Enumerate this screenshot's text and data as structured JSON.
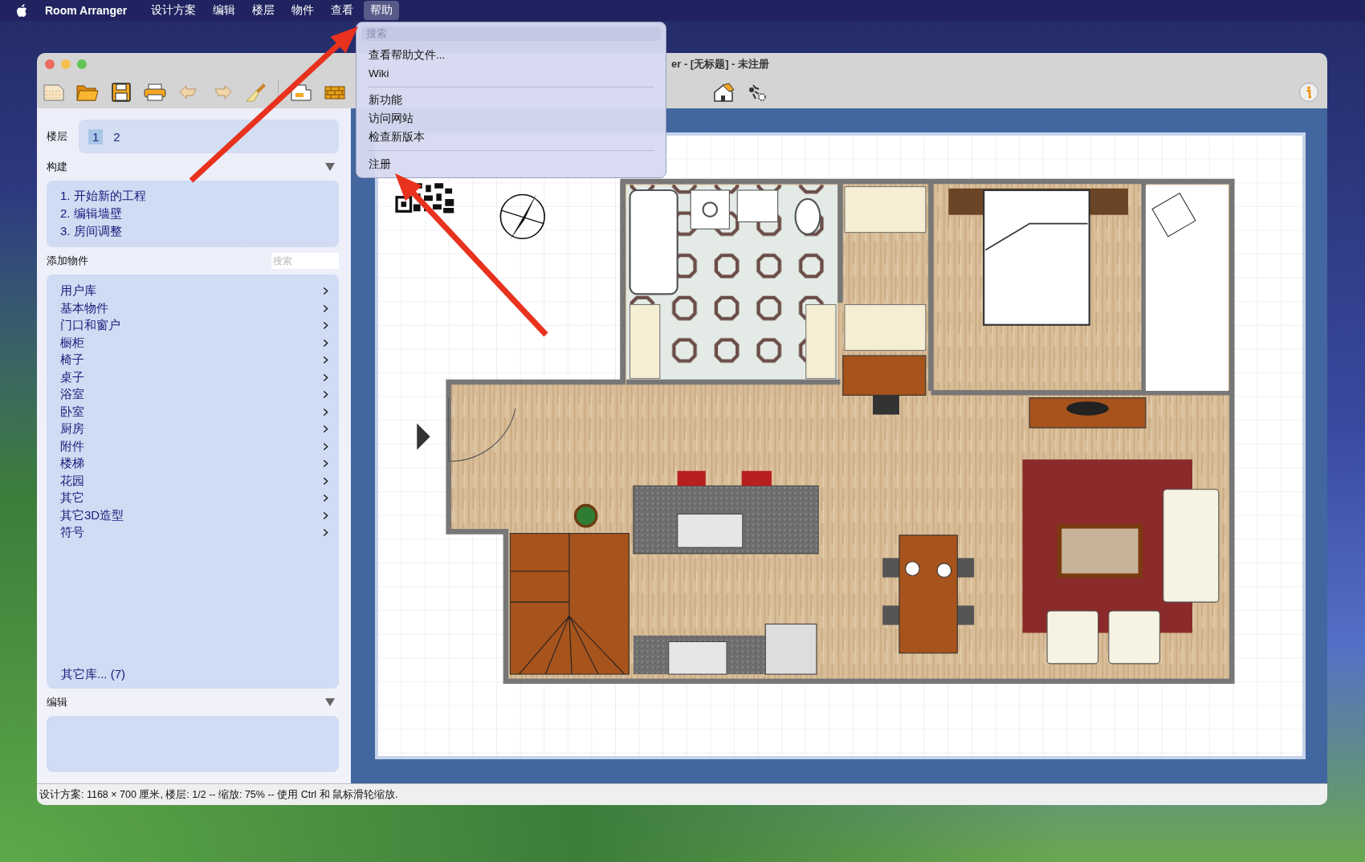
{
  "menu_bar": {
    "app_name": "Room Arranger",
    "menus": [
      {
        "label": "设计方案",
        "selected": false
      },
      {
        "label": "编辑",
        "selected": false
      },
      {
        "label": "楼层",
        "selected": false
      },
      {
        "label": "物件",
        "selected": false
      },
      {
        "label": "查看",
        "selected": false
      },
      {
        "label": "帮助",
        "selected": true
      }
    ]
  },
  "help_menu": {
    "search": {
      "placeholder": "搜索"
    },
    "groups": [
      [
        "查看帮助文件...",
        "Wiki"
      ],
      [
        "新功能",
        "访问网站",
        "检查新版本"
      ],
      [
        "注册"
      ]
    ]
  },
  "window": {
    "title": "er - [无标题] - 未注册"
  },
  "sidebar": {
    "floors": {
      "label": "楼层",
      "tabs": [
        {
          "label": "1",
          "selected": true
        },
        {
          "label": "2",
          "selected": false
        }
      ]
    },
    "build": {
      "title": "构建",
      "steps": [
        "1. 开始新的工程",
        "2. 编辑墙壁",
        "3. 房间调整"
      ]
    },
    "add_objects": {
      "title": "添加物件",
      "search": {
        "placeholder": "搜索"
      },
      "categories": [
        "用户库",
        "基本物件",
        "门口和窗户",
        "橱柜",
        "椅子",
        "桌子",
        "浴室",
        "卧室",
        "厨房",
        "附件",
        "楼梯",
        "花园",
        "其它",
        "其它3D造型",
        "符号"
      ],
      "more_link": "其它库... (7)"
    },
    "edit": {
      "title": "编辑"
    }
  },
  "status_bar": "设计方案: 1168 × 700 厘米, 楼层: 1/2 -- 缩放: 75% -- 使用 Ctrl 和 鼠标滑轮缩放."
}
